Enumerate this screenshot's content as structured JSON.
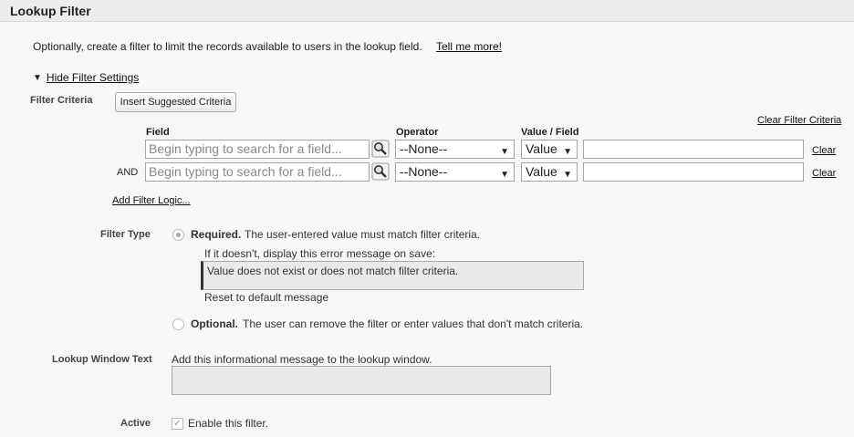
{
  "header": {
    "title": "Lookup Filter"
  },
  "intro": {
    "text": "Optionally, create a filter to limit the records available to users in the lookup field.",
    "tell_me_more": "Tell me more!"
  },
  "toggle": {
    "label": "Hide Filter Settings"
  },
  "filter_criteria": {
    "label": "Filter Criteria",
    "insert_button": "Insert Suggested Criteria",
    "clear_all": "Clear Filter Criteria",
    "columns": {
      "field": "Field",
      "operator": "Operator",
      "value_field": "Value / Field"
    },
    "rows": [
      {
        "prefix": "",
        "field_placeholder": "Begin typing to search for a field...",
        "operator": "--None--",
        "value_type": "Value",
        "value": "",
        "clear": "Clear"
      },
      {
        "prefix": "AND",
        "field_placeholder": "Begin typing to search for a field...",
        "operator": "--None--",
        "value_type": "Value",
        "value": "",
        "clear": "Clear"
      }
    ],
    "add_logic": "Add Filter Logic..."
  },
  "filter_type": {
    "label": "Filter Type",
    "required": {
      "title": "Required.",
      "description": "The user-entered value must match filter criteria.",
      "selected": true,
      "error_prompt": "If it doesn't, display this error message on save:",
      "error_message": "Value does not exist or does not match filter criteria.",
      "reset_label": "Reset to default message"
    },
    "optional": {
      "title": "Optional.",
      "description": "The user can remove the filter or enter values that don't match criteria.",
      "selected": false
    }
  },
  "lookup_window": {
    "label": "Lookup Window Text",
    "prompt": "Add this informational message to the lookup window.",
    "value": ""
  },
  "active": {
    "label": "Active",
    "checkbox_label": "Enable this filter.",
    "checked": true
  }
}
